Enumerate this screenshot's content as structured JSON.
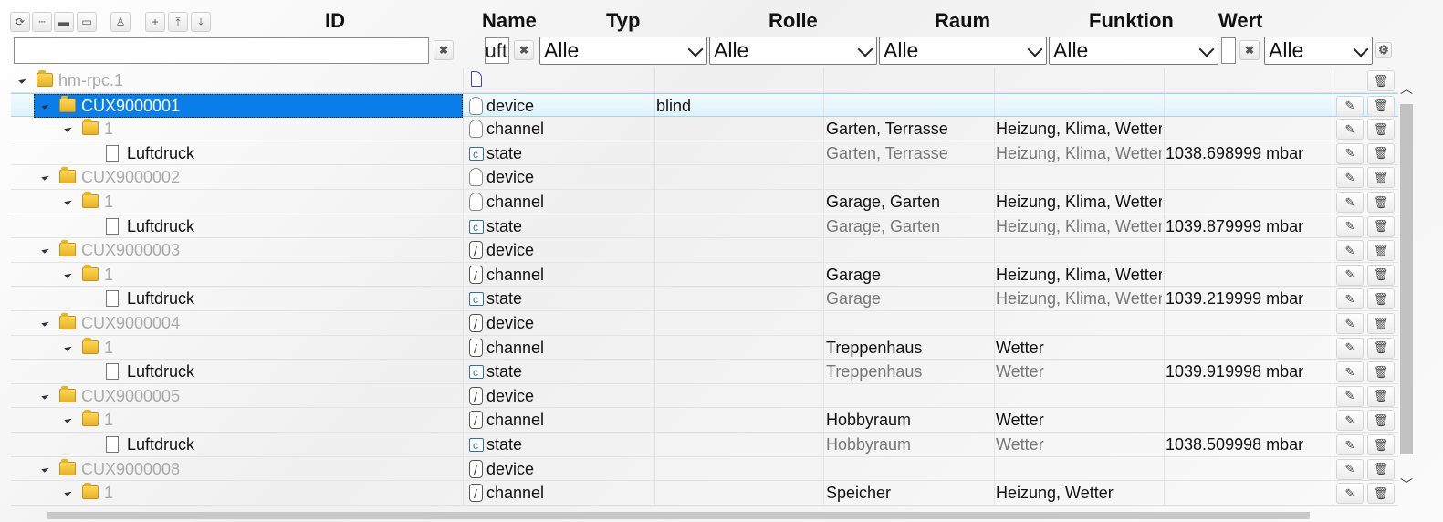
{
  "toolbar": {
    "buttons": [
      "refresh-icon",
      "collapse-icon",
      "folder-icon",
      "folder-open-icon",
      "user-icon",
      "add-icon",
      "upload-icon",
      "download-icon"
    ],
    "glyphs": [
      "⟳",
      "┄",
      "▬",
      "▭",
      "♙",
      "+",
      "⤒",
      "⤓"
    ]
  },
  "headers": {
    "id": "ID",
    "name": "Name",
    "typ": "Typ",
    "rolle": "Rolle",
    "raum": "Raum",
    "funktion": "Funktion",
    "wert": "Wert"
  },
  "filters": {
    "id_value": "",
    "name_value": "uft",
    "typ": "Alle",
    "rolle": "Alle",
    "raum": "Alle",
    "funktion": "Alle",
    "wert_value": "",
    "wert_select": "Alle",
    "clear_glyph": "✖",
    "settings_glyph": "⚙"
  },
  "actions": {
    "edit_glyph": "✎",
    "delete_glyph": "🗑"
  },
  "scroll": {
    "up": "︿",
    "down": "﹀",
    "left": "‹",
    "right": "›"
  },
  "rows": [
    {
      "id": "hm-rpc.1",
      "name": "",
      "typ": "",
      "rolle": "",
      "raum": "",
      "funktion": "",
      "wert": ""
    },
    {
      "id": "CUX9000001",
      "name": "device",
      "typ": "blind",
      "rolle": "",
      "raum": "",
      "funktion": "",
      "wert": ""
    },
    {
      "id": "1",
      "name": "channel",
      "typ": "",
      "rolle": "",
      "raum": "Garten, Terrasse",
      "funktion": "Heizung, Klima, Wetter",
      "wert": ""
    },
    {
      "id": "Luftdruck",
      "name": "state",
      "typ": "",
      "rolle": "",
      "raum": "Garten, Terrasse",
      "funktion": "Heizung, Klima, Wetter",
      "wert": "1038.698999 mbar"
    },
    {
      "id": "CUX9000002",
      "name": "device",
      "typ": "",
      "rolle": "",
      "raum": "",
      "funktion": "",
      "wert": ""
    },
    {
      "id": "1",
      "name": "channel",
      "typ": "",
      "rolle": "",
      "raum": "Garage, Garten",
      "funktion": "Heizung, Klima, Wetter",
      "wert": ""
    },
    {
      "id": "Luftdruck",
      "name": "state",
      "typ": "",
      "rolle": "",
      "raum": "Garage, Garten",
      "funktion": "Heizung, Klima, Wetter",
      "wert": "1039.879999 mbar"
    },
    {
      "id": "CUX9000003",
      "name": "device",
      "typ": "",
      "rolle": "",
      "raum": "",
      "funktion": "",
      "wert": ""
    },
    {
      "id": "1",
      "name": "channel",
      "typ": "",
      "rolle": "",
      "raum": "Garage",
      "funktion": "Heizung, Klima, Wetter",
      "wert": ""
    },
    {
      "id": "Luftdruck",
      "name": "state",
      "typ": "",
      "rolle": "",
      "raum": "Garage",
      "funktion": "Heizung, Klima, Wetter",
      "wert": "1039.219999 mbar"
    },
    {
      "id": "CUX9000004",
      "name": "device",
      "typ": "",
      "rolle": "",
      "raum": "",
      "funktion": "",
      "wert": ""
    },
    {
      "id": "1",
      "name": "channel",
      "typ": "",
      "rolle": "",
      "raum": "Treppenhaus",
      "funktion": "Wetter",
      "wert": ""
    },
    {
      "id": "Luftdruck",
      "name": "state",
      "typ": "",
      "rolle": "",
      "raum": "Treppenhaus",
      "funktion": "Wetter",
      "wert": "1039.919998 mbar"
    },
    {
      "id": "CUX9000005",
      "name": "device",
      "typ": "",
      "rolle": "",
      "raum": "",
      "funktion": "",
      "wert": ""
    },
    {
      "id": "1",
      "name": "channel",
      "typ": "",
      "rolle": "",
      "raum": "Hobbyraum",
      "funktion": "Wetter",
      "wert": ""
    },
    {
      "id": "Luftdruck",
      "name": "state",
      "typ": "",
      "rolle": "",
      "raum": "Hobbyraum",
      "funktion": "Wetter",
      "wert": "1038.509998 mbar"
    },
    {
      "id": "CUX9000008",
      "name": "device",
      "typ": "",
      "rolle": "",
      "raum": "",
      "funktion": "",
      "wert": ""
    },
    {
      "id": "1",
      "name": "channel",
      "typ": "",
      "rolle": "",
      "raum": "Speicher",
      "funktion": "Heizung, Wetter",
      "wert": ""
    }
  ]
}
